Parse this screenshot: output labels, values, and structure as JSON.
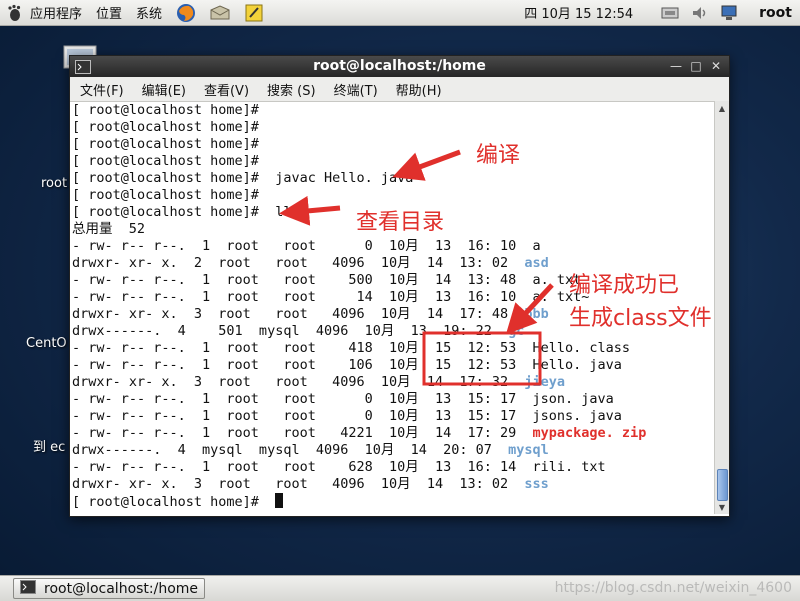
{
  "top_panel": {
    "menus": [
      "应用程序",
      "位置",
      "系统"
    ],
    "clock": "四 10月 15 12:54",
    "user": "root",
    "launchers": [
      "firefox-icon",
      "mail-icon",
      "notes-icon"
    ],
    "tray": [
      "network-icon",
      "volume-icon",
      "display-icon"
    ]
  },
  "desktop": {
    "labels": [
      "root",
      "CentO",
      "到 ec"
    ]
  },
  "window": {
    "title": "root@localhost:/home",
    "menus": [
      "文件(F)",
      "编辑(E)",
      "查看(V)",
      "搜索 (S)",
      "终端(T)",
      "帮助(H)"
    ]
  },
  "terminal": {
    "lines": [
      {
        "text": "[ root@localhost home]#"
      },
      {
        "text": "[ root@localhost home]#"
      },
      {
        "text": "[ root@localhost home]#"
      },
      {
        "text": "[ root@localhost home]#"
      },
      {
        "text": "[ root@localhost home]#  javac Hello. java"
      },
      {
        "text": "[ root@localhost home]#"
      },
      {
        "text": "[ root@localhost home]#  ll"
      },
      {
        "text": "总用量  52"
      },
      {
        "text": "- rw- r-- r--.  1  root   root      0  10月  13  16: 10  ",
        "name": "a",
        "style": ""
      },
      {
        "text": "drwxr- xr- x.  2  root   root   4096  10月  14  13: 02  ",
        "name": "asd",
        "style": "d-blue"
      },
      {
        "text": "- rw- r-- r--.  1  root   root    500  10月  14  13: 48  ",
        "name": "a. txt",
        "style": ""
      },
      {
        "text": "- rw- r-- r--.  1  root   root     14  10月  13  16: 10  ",
        "name": "a. txt~",
        "style": ""
      },
      {
        "text": "drwxr- xr- x.  3  root   root   4096  10月  14  17: 48  ",
        "name": "bbb",
        "style": "d-blue"
      },
      {
        "text": "drwx------.  4    501  mysql  4096  10月  13  19: 22  ",
        "name": "gc",
        "style": "d-blue"
      },
      {
        "text": "- rw- r-- r--.  1  root   root    418  10月  15  12: 53  ",
        "name": "Hello. class",
        "style": ""
      },
      {
        "text": "- rw- r-- r--.  1  root   root    106  10月  15  12: 53  ",
        "name": "Hello. java",
        "style": ""
      },
      {
        "text": "drwxr- xr- x.  3  root   root   4096  10月  14  17: 32  ",
        "name": "jieya",
        "style": "d-blue"
      },
      {
        "text": "- rw- r-- r--.  1  root   root      0  10月  13  15: 17  ",
        "name": "json. java",
        "style": ""
      },
      {
        "text": "- rw- r-- r--.  1  root   root      0  10月  13  15: 17  ",
        "name": "jsons. java",
        "style": ""
      },
      {
        "text": "- rw- r-- r--.  1  root   root   4221  10月  14  17: 29  ",
        "name": "mypackage. zip",
        "style": "d-red"
      },
      {
        "text": "drwx------.  4  mysql  mysql  4096  10月  14  20: 07  ",
        "name": "mysql",
        "style": "d-blue"
      },
      {
        "text": "- rw- r-- r--.  1  root   root    628  10月  13  16: 14  ",
        "name": "rili. txt",
        "style": ""
      },
      {
        "text": "drwxr- xr- x.  3  root   root   4096  10月  14  13: 02  ",
        "name": "sss",
        "style": "d-blue"
      }
    ],
    "prompt": "[ root@localhost home]#  "
  },
  "annotations": {
    "compile": "编译",
    "view_dir": "查看目录",
    "success_line1": "编译成功已",
    "success_line2": "生成class文件",
    "color": "#e0302c"
  },
  "taskbar": {
    "task_label": "root@localhost:/home",
    "watermark": "https://blog.csdn.net/weixin_4600"
  }
}
